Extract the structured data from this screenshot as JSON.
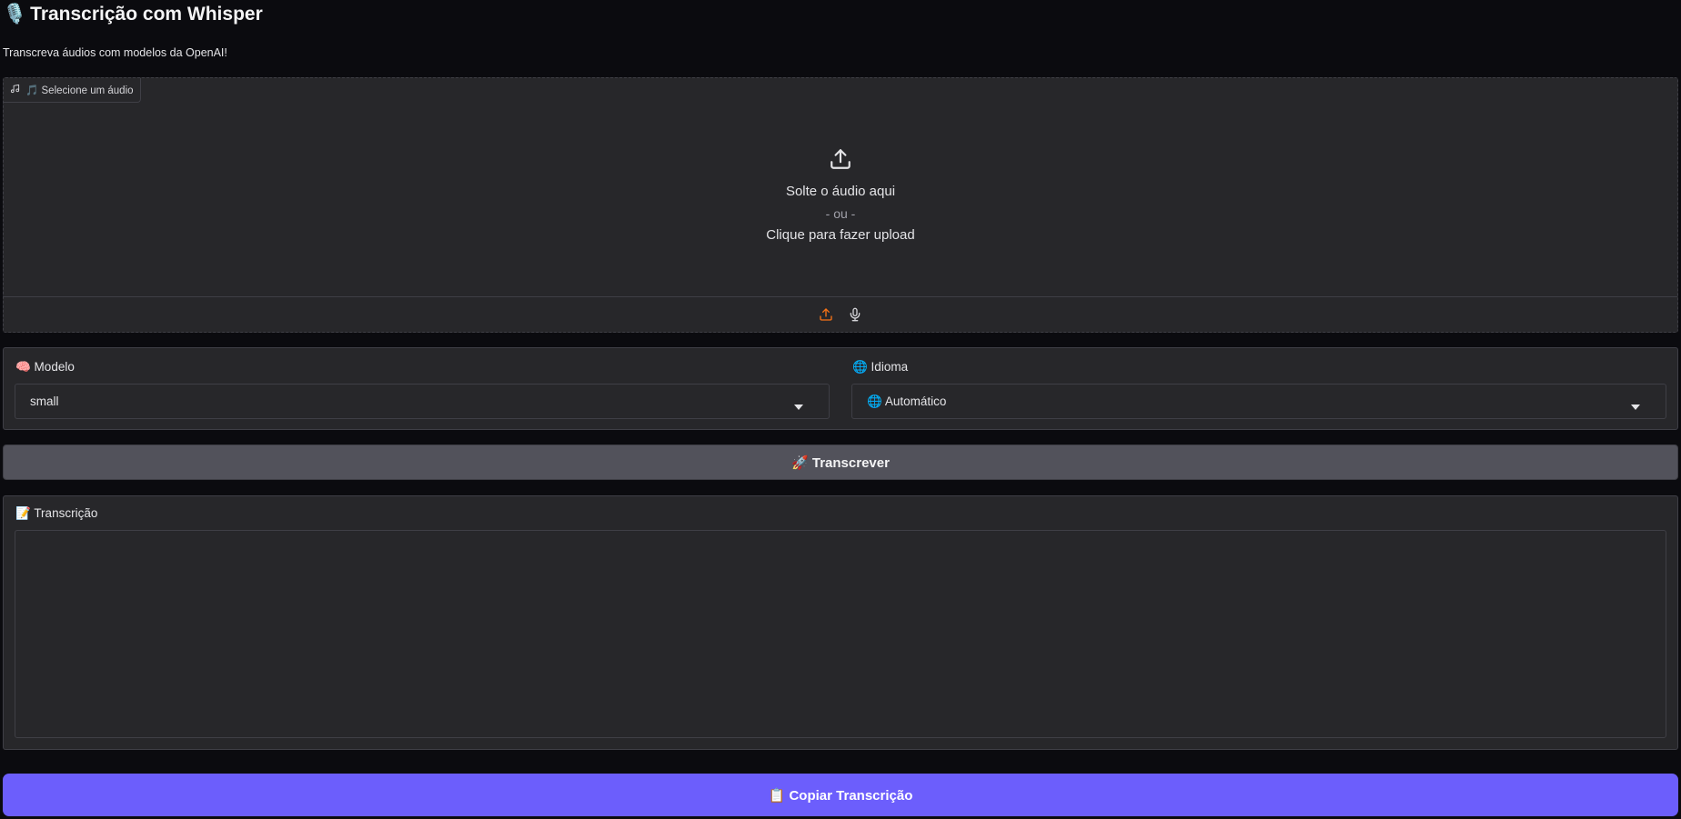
{
  "header": {
    "title_emoji": "🎙️",
    "title": "Transcrição com Whisper",
    "subtitle": "Transcreva áudios com modelos da OpenAI!"
  },
  "audio_input": {
    "label": "🎵 Selecione um áudio",
    "drop_text": "Solte o áudio aqui",
    "or_text": "- ou -",
    "click_text": "Clique para fazer upload",
    "icons": [
      "music-icon",
      "upload-icon",
      "microphone-icon"
    ],
    "accent_color": "#f97316"
  },
  "settings": {
    "model_label": "🧠 Modelo",
    "model_value": "small",
    "language_label": "🌐 Idioma",
    "language_value": "🌐 Automático"
  },
  "actions": {
    "transcribe_label": "🚀 Transcrever",
    "copy_label": "📋 Copiar Transcrição",
    "copy_color": "#6c5efc"
  },
  "output": {
    "label": "📝 Transcrição",
    "value": ""
  }
}
